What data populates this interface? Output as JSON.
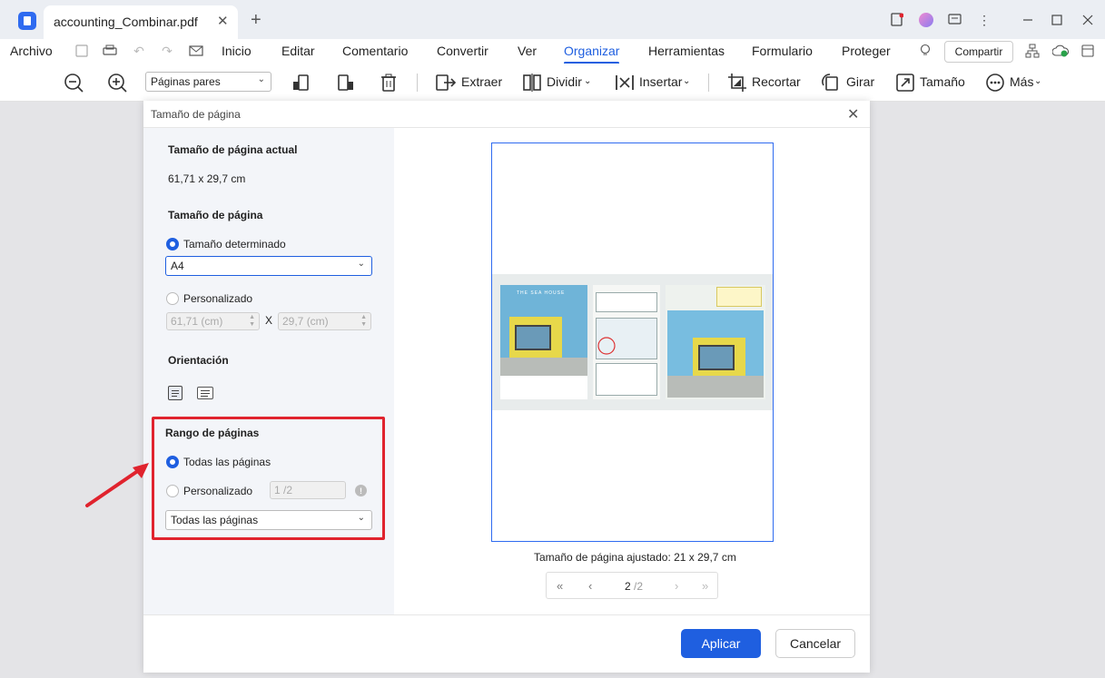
{
  "tab": {
    "title": "accounting_Combinar.pdf",
    "close": "✕",
    "new": "+"
  },
  "menu": {
    "archivo": "Archivo",
    "items": [
      "Inicio",
      "Editar",
      "Comentario",
      "Convertir",
      "Ver",
      "Organizar",
      "Herramientas",
      "Formulario",
      "Proteger"
    ],
    "active": "Organizar",
    "share": "Compartir"
  },
  "toolbar": {
    "page_select": "Páginas pares",
    "extraer": "Extraer",
    "dividir": "Dividir",
    "insertar": "Insertar",
    "recortar": "Recortar",
    "girar": "Girar",
    "tamano": "Tamaño",
    "mas": "Más"
  },
  "dialog": {
    "title": "Tamaño de página",
    "current_size_label": "Tamaño de página actual",
    "current_size_value": "61,71 x 29,7 cm",
    "page_size_label": "Tamaño de página",
    "fixed_size_label": "Tamaño determinado",
    "fixed_size_value": "A4",
    "custom_label": "Personalizado",
    "width_placeholder": "61,71 (cm)",
    "height_placeholder": "29,7 (cm)",
    "x": "X",
    "orientation_label": "Orientación",
    "range_label": "Rango de páginas",
    "all_pages_label": "Todas las páginas",
    "range_custom_label": "Personalizado",
    "range_custom_placeholder": "1 /2",
    "range_select_value": "Todas las páginas",
    "adjusted_size": "Tamaño de página ajustado: 21 x 29,7 cm",
    "page_current": "2",
    "page_total": "/2",
    "preview_title": "THE SEA HOUSE",
    "apply": "Aplicar",
    "cancel": "Cancelar"
  },
  "colors": {
    "accent": "#1f5fe0",
    "highlight": "#e0232e"
  }
}
